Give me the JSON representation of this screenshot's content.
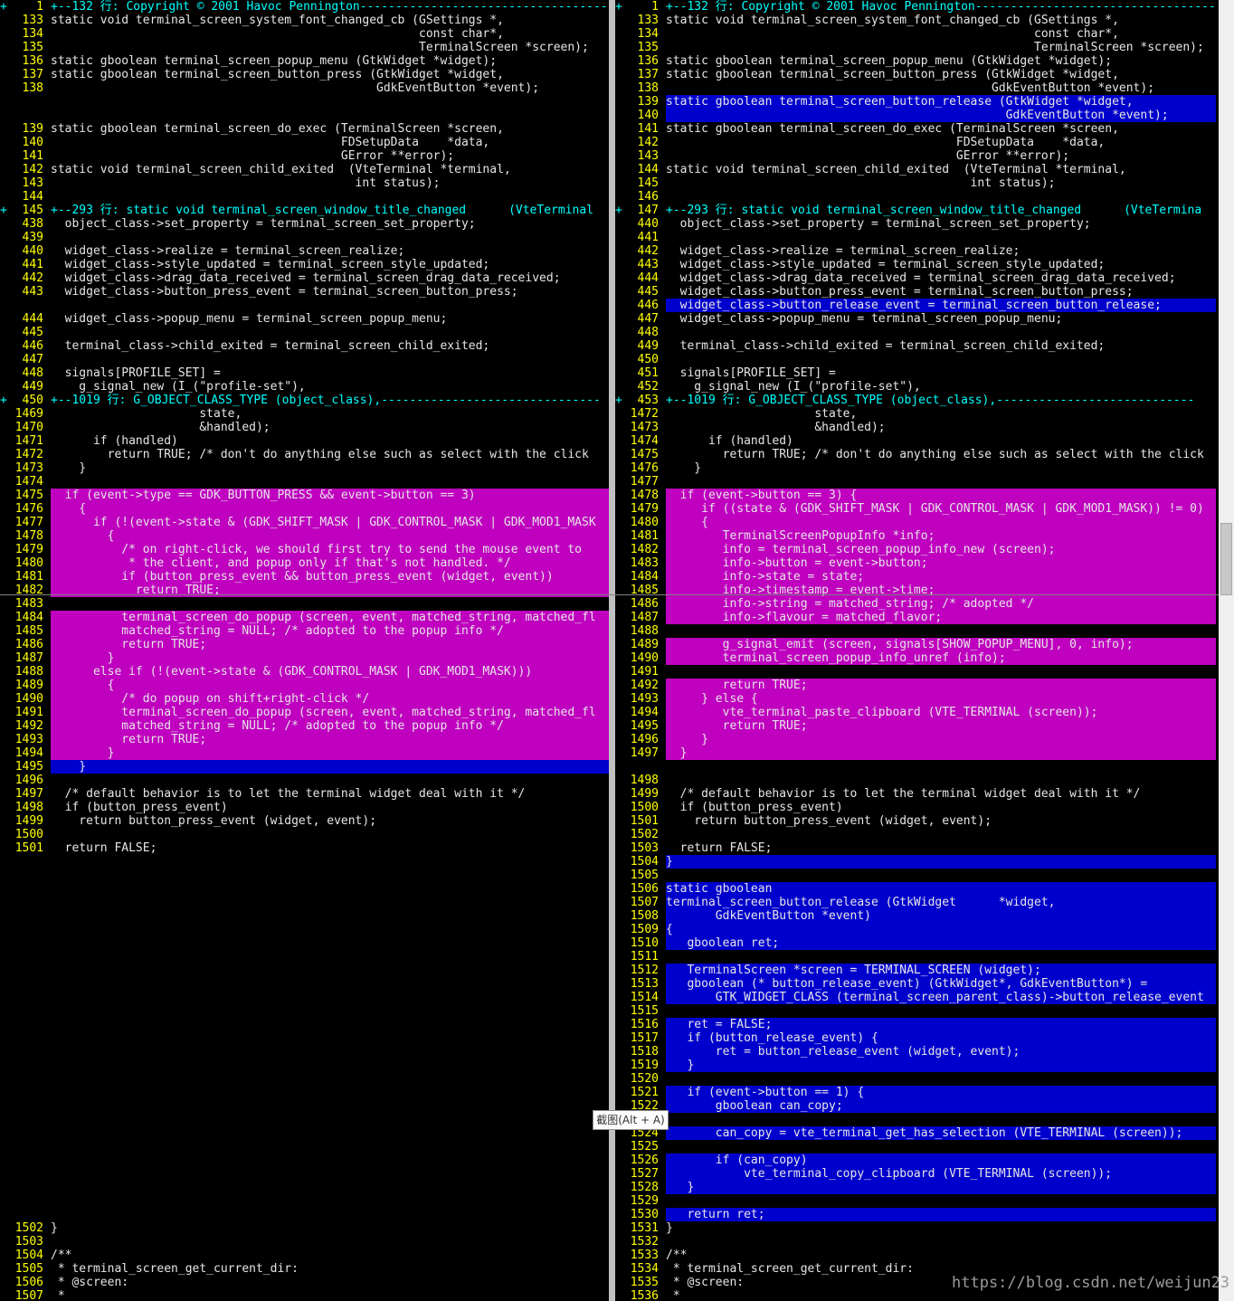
{
  "tooltip": "截图(Alt + A)",
  "watermark": "https://blog.csdn.net/weijun23",
  "left": [
    {
      "f": "+",
      "n": "1",
      "t": "+--132 行: Copyright © 2001 Havoc Pennington------------------------------------------",
      "c": "fold"
    },
    {
      "n": "133",
      "t": "static void terminal_screen_system_font_changed_cb (GSettings *,"
    },
    {
      "n": "134",
      "t": "                                                    const char*,"
    },
    {
      "n": "135",
      "t": "                                                    TerminalScreen *screen);"
    },
    {
      "n": "136",
      "t": "static gboolean terminal_screen_popup_menu (GtkWidget *widget);"
    },
    {
      "n": "137",
      "t": "static gboolean terminal_screen_button_press (GtkWidget *widget,"
    },
    {
      "n": "138",
      "t": "                                              GdkEventButton *event);"
    },
    {
      "n": "",
      "t": "",
      "c": "filler"
    },
    {
      "n": "",
      "t": "",
      "c": "filler"
    },
    {
      "n": "139",
      "t": "static gboolean terminal_screen_do_exec (TerminalScreen *screen,"
    },
    {
      "n": "140",
      "t": "                                         FDSetupData    *data,"
    },
    {
      "n": "141",
      "t": "                                         GError **error);"
    },
    {
      "n": "142",
      "t": "static void terminal_screen_child_exited  (VteTerminal *terminal,"
    },
    {
      "n": "143",
      "t": "                                           int status);"
    },
    {
      "n": "144",
      "t": ""
    },
    {
      "f": "+",
      "n": "145",
      "t": "+--293 行: static void terminal_screen_window_title_changed      (VteTerminal",
      "c": "fold"
    },
    {
      "n": "438",
      "t": "  object_class->set_property = terminal_screen_set_property;"
    },
    {
      "n": "439",
      "t": ""
    },
    {
      "n": "440",
      "t": "  widget_class->realize = terminal_screen_realize;"
    },
    {
      "n": "441",
      "t": "  widget_class->style_updated = terminal_screen_style_updated;"
    },
    {
      "n": "442",
      "t": "  widget_class->drag_data_received = terminal_screen_drag_data_received;"
    },
    {
      "n": "443",
      "t": "  widget_class->button_press_event = terminal_screen_button_press;"
    },
    {
      "n": "",
      "t": "",
      "c": "filler"
    },
    {
      "n": "444",
      "t": "  widget_class->popup_menu = terminal_screen_popup_menu;"
    },
    {
      "n": "445",
      "t": ""
    },
    {
      "n": "446",
      "t": "  terminal_class->child_exited = terminal_screen_child_exited;"
    },
    {
      "n": "447",
      "t": ""
    },
    {
      "n": "448",
      "t": "  signals[PROFILE_SET] ="
    },
    {
      "n": "449",
      "t": "    g_signal_new (I_(\"profile-set\"),"
    },
    {
      "f": "+",
      "n": "450",
      "t": "+--1019 行: G_OBJECT_CLASS_TYPE (object_class),-------------------------------",
      "c": "fold"
    },
    {
      "n": "1469",
      "t": "                     state,"
    },
    {
      "n": "1470",
      "t": "                     &handled);"
    },
    {
      "n": "1471",
      "t": "      if (handled)"
    },
    {
      "n": "1472",
      "t": "        return TRUE; /* don't do anything else such as select with the click"
    },
    {
      "n": "1473",
      "t": "    }"
    },
    {
      "n": "1474",
      "t": ""
    },
    {
      "n": "1475",
      "t": "  if (event->type == GDK_BUTTON_PRESS && event->button == 3)",
      "c": "change"
    },
    {
      "n": "1476",
      "t": "    {",
      "c": "change"
    },
    {
      "n": "1477",
      "t": "      if (!(event->state & (GDK_SHIFT_MASK | GDK_CONTROL_MASK | GDK_MOD1_MASK",
      "c": "change"
    },
    {
      "n": "1478",
      "t": "        {",
      "c": "change"
    },
    {
      "n": "1479",
      "t": "          /* on right-click, we should first try to send the mouse event to",
      "c": "change"
    },
    {
      "n": "1480",
      "t": "           * the client, and popup only if that's not handled. */",
      "c": "change"
    },
    {
      "n": "1481",
      "t": "          if (button_press_event && button_press_event (widget, event))",
      "c": "change"
    },
    {
      "n": "1482",
      "t": "            return TRUE;",
      "c": "change"
    },
    {
      "n": "1483",
      "t": "",
      "c": "change"
    },
    {
      "n": "1484",
      "t": "          terminal_screen_do_popup (screen, event, matched_string, matched_fl",
      "c": "change"
    },
    {
      "n": "1485",
      "t": "          matched_string = NULL; /* adopted to the popup info */",
      "c": "change"
    },
    {
      "n": "1486",
      "t": "          return TRUE;",
      "c": "change"
    },
    {
      "n": "1487",
      "t": "        }",
      "c": "change"
    },
    {
      "n": "1488",
      "t": "      else if (!(event->state & (GDK_CONTROL_MASK | GDK_MOD1_MASK)))",
      "c": "change"
    },
    {
      "n": "1489",
      "t": "        {",
      "c": "change"
    },
    {
      "n": "1490",
      "t": "          /* do popup on shift+right-click */",
      "c": "change"
    },
    {
      "n": "1491",
      "t": "          terminal_screen_do_popup (screen, event, matched_string, matched_fl",
      "c": "change"
    },
    {
      "n": "1492",
      "t": "          matched_string = NULL; /* adopted to the popup info */",
      "c": "change"
    },
    {
      "n": "1493",
      "t": "          return TRUE;",
      "c": "change"
    },
    {
      "n": "1494",
      "t": "        }",
      "c": "change"
    },
    {
      "n": "1495",
      "t": "    }",
      "c": "add"
    },
    {
      "n": "1496",
      "t": ""
    },
    {
      "n": "1497",
      "t": "  /* default behavior is to let the terminal widget deal with it */"
    },
    {
      "n": "1498",
      "t": "  if (button_press_event)"
    },
    {
      "n": "1499",
      "t": "    return button_press_event (widget, event);"
    },
    {
      "n": "1500",
      "t": ""
    },
    {
      "n": "1501",
      "t": "  return FALSE;"
    },
    {
      "n": "",
      "t": "",
      "c": "filler"
    },
    {
      "n": "",
      "t": "",
      "c": "filler"
    },
    {
      "n": "",
      "t": "",
      "c": "filler"
    },
    {
      "n": "",
      "t": "",
      "c": "filler"
    },
    {
      "n": "",
      "t": "",
      "c": "filler"
    },
    {
      "n": "",
      "t": "",
      "c": "filler"
    },
    {
      "n": "",
      "t": "",
      "c": "filler"
    },
    {
      "n": "",
      "t": "",
      "c": "filler"
    },
    {
      "n": "",
      "t": "",
      "c": "filler"
    },
    {
      "n": "",
      "t": "",
      "c": "filler"
    },
    {
      "n": "",
      "t": "",
      "c": "filler"
    },
    {
      "n": "",
      "t": "",
      "c": "filler"
    },
    {
      "n": "",
      "t": "",
      "c": "filler"
    },
    {
      "n": "",
      "t": "",
      "c": "filler"
    },
    {
      "n": "",
      "t": "",
      "c": "filler"
    },
    {
      "n": "",
      "t": "",
      "c": "filler"
    },
    {
      "n": "",
      "t": "",
      "c": "filler"
    },
    {
      "n": "",
      "t": "",
      "c": "filler"
    },
    {
      "n": "",
      "t": "",
      "c": "filler"
    },
    {
      "n": "",
      "t": "",
      "c": "filler"
    },
    {
      "n": "",
      "t": "",
      "c": "filler"
    },
    {
      "n": "",
      "t": "",
      "c": "filler"
    },
    {
      "n": "",
      "t": "",
      "c": "filler"
    },
    {
      "n": "",
      "t": "",
      "c": "filler"
    },
    {
      "n": "",
      "t": "",
      "c": "filler"
    },
    {
      "n": "",
      "t": "",
      "c": "filler"
    },
    {
      "n": "",
      "t": "",
      "c": "filler"
    },
    {
      "n": "1502",
      "t": "}"
    },
    {
      "n": "1503",
      "t": ""
    },
    {
      "n": "1504",
      "t": "/**"
    },
    {
      "n": "1505",
      "t": " * terminal_screen_get_current_dir:"
    },
    {
      "n": "1506",
      "t": " * @screen:"
    },
    {
      "n": "1507",
      "t": " *"
    }
  ],
  "right": [
    {
      "f": "+",
      "n": "1",
      "t": "+--132 行: Copyright © 2001 Havoc Pennington------------------------------------------",
      "c": "fold"
    },
    {
      "n": "133",
      "t": "static void terminal_screen_system_font_changed_cb (GSettings *,"
    },
    {
      "n": "134",
      "t": "                                                    const char*,"
    },
    {
      "n": "135",
      "t": "                                                    TerminalScreen *screen);"
    },
    {
      "n": "136",
      "t": "static gboolean terminal_screen_popup_menu (GtkWidget *widget);"
    },
    {
      "n": "137",
      "t": "static gboolean terminal_screen_button_press (GtkWidget *widget,"
    },
    {
      "n": "138",
      "t": "                                              GdkEventButton *event);"
    },
    {
      "n": "139",
      "t": "static gboolean terminal_screen_button_release (GtkWidget *widget,",
      "c": "add"
    },
    {
      "n": "140",
      "t": "                                                GdkEventButton *event);",
      "c": "add"
    },
    {
      "n": "141",
      "t": "static gboolean terminal_screen_do_exec (TerminalScreen *screen,"
    },
    {
      "n": "142",
      "t": "                                         FDSetupData    *data,"
    },
    {
      "n": "143",
      "t": "                                         GError **error);"
    },
    {
      "n": "144",
      "t": "static void terminal_screen_child_exited  (VteTerminal *terminal,"
    },
    {
      "n": "145",
      "t": "                                           int status);"
    },
    {
      "n": "146",
      "t": ""
    },
    {
      "f": "+",
      "n": "147",
      "t": "+--293 行: static void terminal_screen_window_title_changed      (VteTermina",
      "c": "fold"
    },
    {
      "n": "440",
      "t": "  object_class->set_property = terminal_screen_set_property;"
    },
    {
      "n": "441",
      "t": ""
    },
    {
      "n": "442",
      "t": "  widget_class->realize = terminal_screen_realize;"
    },
    {
      "n": "443",
      "t": "  widget_class->style_updated = terminal_screen_style_updated;"
    },
    {
      "n": "444",
      "t": "  widget_class->drag_data_received = terminal_screen_drag_data_received;"
    },
    {
      "n": "445",
      "t": "  widget_class->button_press_event = terminal_screen_button_press;"
    },
    {
      "n": "446",
      "t": "  widget_class->button_release_event = terminal_screen_button_release;",
      "c": "add"
    },
    {
      "n": "447",
      "t": "  widget_class->popup_menu = terminal_screen_popup_menu;"
    },
    {
      "n": "448",
      "t": ""
    },
    {
      "n": "449",
      "t": "  terminal_class->child_exited = terminal_screen_child_exited;"
    },
    {
      "n": "450",
      "t": ""
    },
    {
      "n": "451",
      "t": "  signals[PROFILE_SET] ="
    },
    {
      "n": "452",
      "t": "    g_signal_new (I_(\"profile-set\"),"
    },
    {
      "f": "+",
      "n": "453",
      "t": "+--1019 行: G_OBJECT_CLASS_TYPE (object_class),----------------------------",
      "c": "fold"
    },
    {
      "n": "1472",
      "t": "                     state,"
    },
    {
      "n": "1473",
      "t": "                     &handled);"
    },
    {
      "n": "1474",
      "t": "      if (handled)"
    },
    {
      "n": "1475",
      "t": "        return TRUE; /* don't do anything else such as select with the click"
    },
    {
      "n": "1476",
      "t": "    }"
    },
    {
      "n": "1477",
      "t": ""
    },
    {
      "n": "1478",
      "t": "  if (event->button == 3) {",
      "c": "change"
    },
    {
      "n": "1479",
      "t": "     if ((state & (GDK_SHIFT_MASK | GDK_CONTROL_MASK | GDK_MOD1_MASK)) != 0)",
      "c": "change"
    },
    {
      "n": "1480",
      "t": "     {",
      "c": "change"
    },
    {
      "n": "1481",
      "t": "        TerminalScreenPopupInfo *info;",
      "c": "change"
    },
    {
      "n": "1482",
      "t": "        info = terminal_screen_popup_info_new (screen);",
      "c": "change"
    },
    {
      "n": "1483",
      "t": "        info->button = event->button;",
      "c": "change"
    },
    {
      "n": "1484",
      "t": "        info->state = state;",
      "c": "change"
    },
    {
      "n": "1485",
      "t": "        info->timestamp = event->time;",
      "c": "change"
    },
    {
      "n": "1486",
      "t": "        info->string = matched_string; /* adopted */",
      "c": "change"
    },
    {
      "n": "1487",
      "t": "        info->flavour = matched_flavor;",
      "c": "change"
    },
    {
      "n": "1488",
      "t": "",
      "c": "change"
    },
    {
      "n": "1489",
      "t": "        g_signal_emit (screen, signals[SHOW_POPUP_MENU], 0, info);",
      "c": "change"
    },
    {
      "n": "1490",
      "t": "        terminal_screen_popup_info_unref (info);",
      "c": "change"
    },
    {
      "n": "1491",
      "t": "",
      "c": "change"
    },
    {
      "n": "1492",
      "t": "        return TRUE;",
      "c": "change"
    },
    {
      "n": "1493",
      "t": "     } else {",
      "c": "change"
    },
    {
      "n": "1494",
      "t": "        vte_terminal_paste_clipboard (VTE_TERMINAL (screen));",
      "c": "change"
    },
    {
      "n": "1495",
      "t": "        return TRUE;",
      "c": "change"
    },
    {
      "n": "1496",
      "t": "     }",
      "c": "change"
    },
    {
      "n": "1497",
      "t": "  }",
      "c": "change"
    },
    {
      "n": "",
      "t": "",
      "c": "filler"
    },
    {
      "n": "1498",
      "t": ""
    },
    {
      "n": "1499",
      "t": "  /* default behavior is to let the terminal widget deal with it */"
    },
    {
      "n": "1500",
      "t": "  if (button_press_event)"
    },
    {
      "n": "1501",
      "t": "    return button_press_event (widget, event);"
    },
    {
      "n": "1502",
      "t": ""
    },
    {
      "n": "1503",
      "t": "  return FALSE;"
    },
    {
      "n": "1504",
      "t": "}",
      "c": "add"
    },
    {
      "n": "1505",
      "t": "",
      "c": "add"
    },
    {
      "n": "1506",
      "t": "static gboolean",
      "c": "add"
    },
    {
      "n": "1507",
      "t": "terminal_screen_button_release (GtkWidget      *widget,",
      "c": "add"
    },
    {
      "n": "1508",
      "t": "       GdkEventButton *event)",
      "c": "add"
    },
    {
      "n": "1509",
      "t": "{",
      "c": "add"
    },
    {
      "n": "1510",
      "t": "   gboolean ret;",
      "c": "add"
    },
    {
      "n": "1511",
      "t": "",
      "c": "add"
    },
    {
      "n": "1512",
      "t": "   TerminalScreen *screen = TERMINAL_SCREEN (widget);",
      "c": "add"
    },
    {
      "n": "1513",
      "t": "   gboolean (* button_release_event) (GtkWidget*, GdkEventButton*) =",
      "c": "add"
    },
    {
      "n": "1514",
      "t": "       GTK_WIDGET_CLASS (terminal_screen_parent_class)->button_release_event",
      "c": "add"
    },
    {
      "n": "1515",
      "t": "",
      "c": "add"
    },
    {
      "n": "1516",
      "t": "   ret = FALSE;",
      "c": "add"
    },
    {
      "n": "1517",
      "t": "   if (button_release_event) {",
      "c": "add"
    },
    {
      "n": "1518",
      "t": "       ret = button_release_event (widget, event);",
      "c": "add"
    },
    {
      "n": "1519",
      "t": "   }",
      "c": "add"
    },
    {
      "n": "1520",
      "t": "",
      "c": "add"
    },
    {
      "n": "1521",
      "t": "   if (event->button == 1) {",
      "c": "add"
    },
    {
      "n": "1522",
      "t": "       gboolean can_copy;",
      "c": "add"
    },
    {
      "n": "1523",
      "t": "",
      "c": "add"
    },
    {
      "n": "1524",
      "t": "       can_copy = vte_terminal_get_has_selection (VTE_TERMINAL (screen));",
      "c": "add"
    },
    {
      "n": "1525",
      "t": "",
      "c": "add"
    },
    {
      "n": "1526",
      "t": "       if (can_copy)",
      "c": "add"
    },
    {
      "n": "1527",
      "t": "           vte_terminal_copy_clipboard (VTE_TERMINAL (screen));",
      "c": "add"
    },
    {
      "n": "1528",
      "t": "   }",
      "c": "add"
    },
    {
      "n": "1529",
      "t": "",
      "c": "add"
    },
    {
      "n": "1530",
      "t": "   return ret;",
      "c": "add"
    },
    {
      "n": "1531",
      "t": "}"
    },
    {
      "n": "1532",
      "t": ""
    },
    {
      "n": "1533",
      "t": "/**"
    },
    {
      "n": "1534",
      "t": " * terminal_screen_get_current_dir:"
    },
    {
      "n": "1535",
      "t": " * @screen:"
    },
    {
      "n": "1536",
      "t": " *"
    }
  ]
}
